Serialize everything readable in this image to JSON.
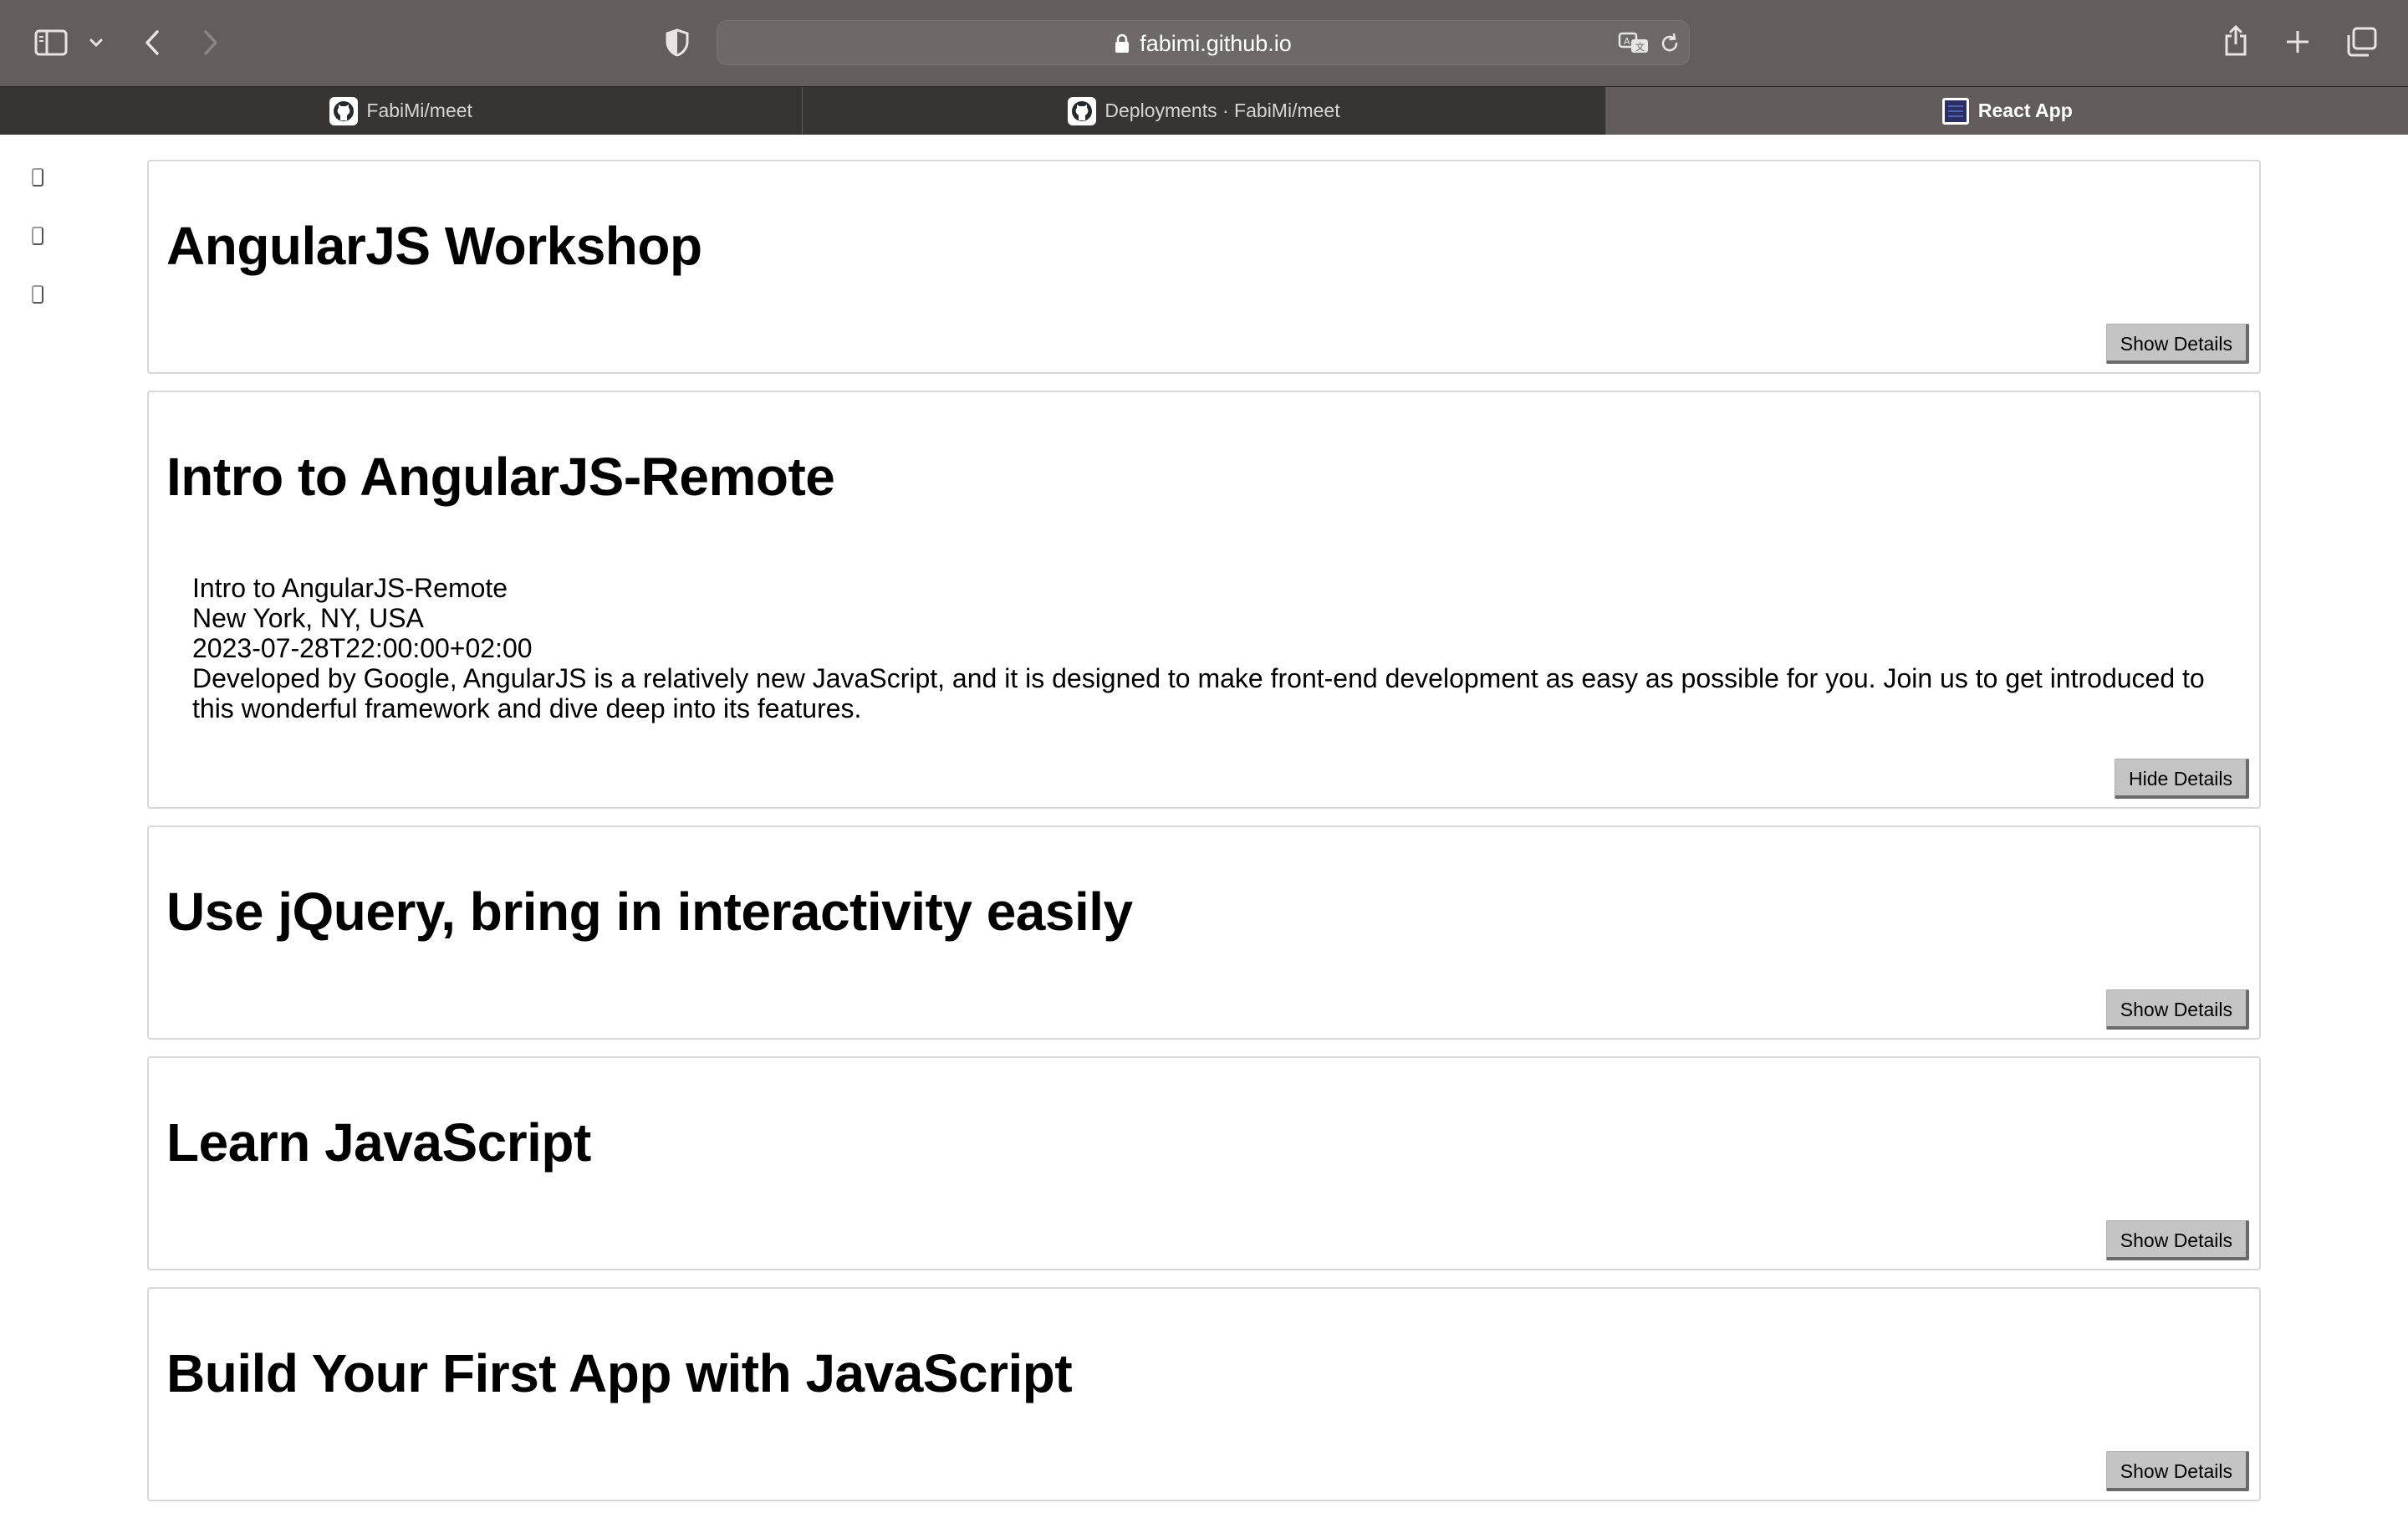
{
  "browser": {
    "url": "fabimi.github.io",
    "icons": {
      "sidebar": "sidebar-icon",
      "chevron": "chevron-down-icon",
      "back": "back-arrow-icon",
      "forward": "forward-arrow-icon",
      "shield": "shield-icon",
      "lock": "lock-icon",
      "translate": "translate-icon",
      "reload": "reload-icon",
      "share": "share-icon",
      "new_tab": "plus-icon",
      "tab_overview": "tab-overview-icon"
    },
    "tabs": [
      {
        "label": "FabiMi/meet",
        "icon": "github-icon",
        "active": false
      },
      {
        "label": "Deployments · FabiMi/meet",
        "icon": "github-icon",
        "active": false
      },
      {
        "label": "React App",
        "icon": "app-favicon",
        "active": true
      }
    ]
  },
  "events": [
    {
      "title": "AngularJS Workshop",
      "button": "Show Details"
    },
    {
      "title": "Intro to AngularJS-Remote",
      "button": "Hide Details",
      "details": {
        "summary": "Intro to AngularJS-Remote",
        "location": "New York, NY, USA",
        "start": "2023-07-28T22:00:00+02:00",
        "description": "Developed by Google, AngularJS is a relatively new JavaScript, and it is designed to make front-end development as easy as possible for you. Join us to get introduced to this wonderful framework and dive deep into its features."
      }
    },
    {
      "title": "Use jQuery, bring in interactivity easily",
      "button": "Show Details"
    },
    {
      "title": "Learn JavaScript",
      "button": "Show Details"
    },
    {
      "title": "Build Your First App with JavaScript",
      "button": "Show Details"
    }
  ],
  "colors": {
    "toolbar": "#635e5d",
    "tabbar": "#383433",
    "active_tab": "#625d5c",
    "button": "#c4c4c4"
  }
}
